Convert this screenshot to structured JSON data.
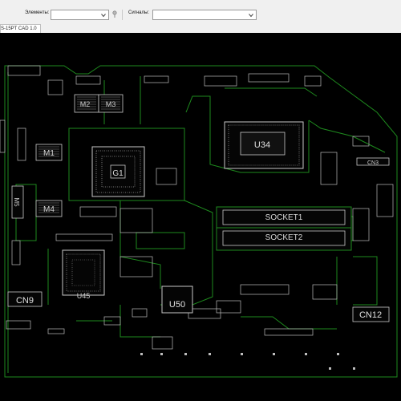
{
  "toolbar": {
    "elements_label": "Элементы:",
    "elements_value": "",
    "signals_label": "Сигналы:",
    "signals_value": ""
  },
  "tab": {
    "title": "S-15PT CAD 1.0"
  },
  "board": {
    "background": "#000000",
    "trace_color": "#1e8a1e",
    "component_color": "#c8c8c8",
    "labels": {
      "u34": "U34",
      "socket1": "SOCKET1",
      "socket2": "SOCKET2",
      "u50": "U50",
      "u45": "U45",
      "cn9": "CN9",
      "cn12": "CN12",
      "cn3": "CN3",
      "g1": "G1",
      "m1": "M1",
      "m2": "M2",
      "m3": "M3",
      "m4": "M4",
      "m5": "M5"
    }
  },
  "icons": {
    "pin_tool": "pin-icon",
    "dropdown": "chevron-down-icon"
  }
}
